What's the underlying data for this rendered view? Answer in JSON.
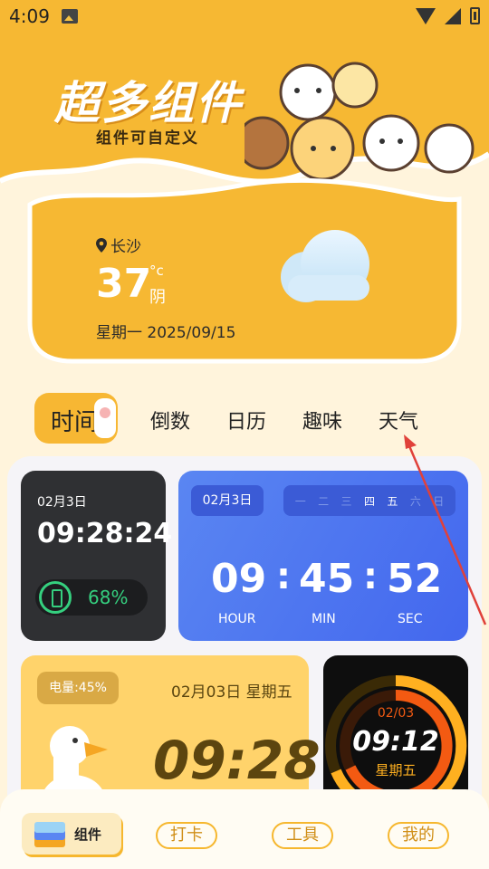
{
  "status_bar": {
    "time": "4:09"
  },
  "banner": {
    "title": "超多组件",
    "subtitle": "组件可自定义"
  },
  "weather": {
    "city": "长沙",
    "temperature": "37",
    "unit": "°c",
    "condition": "阴",
    "date": "星期一 2025/09/15"
  },
  "tabs": {
    "items": [
      "时间",
      "倒数",
      "日历",
      "趣味",
      "天气"
    ],
    "active": "时间"
  },
  "widget_dark": {
    "date": "02月3日",
    "time": "09:28:24",
    "battery": "68%"
  },
  "widget_blue": {
    "date": "02月3日",
    "weekdays": [
      "一",
      "二",
      "三",
      "四",
      "五",
      "六",
      "日"
    ],
    "hour": "09",
    "minute": "45",
    "second": "52",
    "hour_label": "HOUR",
    "minute_label": "MIN",
    "second_label": "SEC"
  },
  "widget_yellow": {
    "battery": "电量:45%",
    "date": "02月03日 星期五",
    "time": "09:28"
  },
  "widget_black": {
    "date": "02/03",
    "time": "09:12",
    "weekday": "星期五"
  },
  "bottom_nav": {
    "home": "组件",
    "checkin": "打卡",
    "tools": "工具",
    "mine": "我的"
  },
  "colors": {
    "primary": "#F7B733",
    "background": "#FFF4DC",
    "blue_widget": "#4A70EF",
    "accent_green": "#35D07F"
  }
}
